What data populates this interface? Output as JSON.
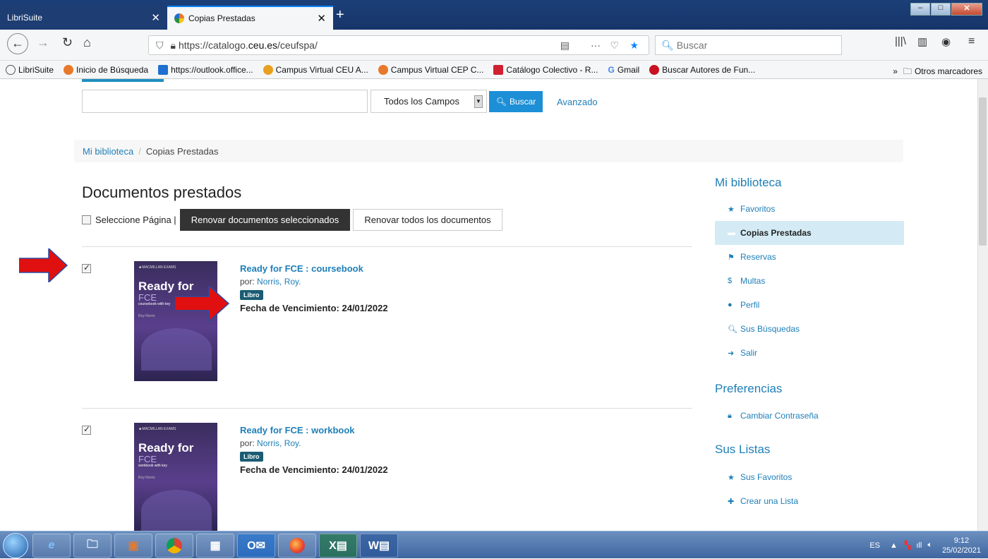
{
  "browser": {
    "tabs": [
      {
        "label": "LibriSuite",
        "active": false
      },
      {
        "label": "Copias Prestadas",
        "active": true
      }
    ],
    "new_tab": "+",
    "url_prefix": "https://catalogo.",
    "url_domain": "ceu.es",
    "url_suffix": "/ceufspa/",
    "search_placeholder": "Buscar",
    "bookmarks": [
      {
        "label": "LibriSuite",
        "color": "#555555"
      },
      {
        "label": "Inicio de Búsqueda",
        "color": "#e8792a"
      },
      {
        "label": "https://outlook.office...",
        "color": "#1e6fd0"
      },
      {
        "label": "Campus Virtual CEU A...",
        "color": "#e8a020"
      },
      {
        "label": "Campus Virtual CEP C...",
        "color": "#e8792a"
      },
      {
        "label": "Catálogo Colectivo - R...",
        "color": "#d02030"
      },
      {
        "label": "Gmail",
        "color": "#4285f4"
      },
      {
        "label": "Buscar Autores de Fun...",
        "color": "#c81020"
      }
    ],
    "other_bookmarks": "Otros marcadores"
  },
  "search": {
    "field_select": "Todos los Campos",
    "button": "Buscar",
    "advanced": "Avanzado"
  },
  "breadcrumb": {
    "home": "Mi biblioteca",
    "separator": "/",
    "current": "Copias Prestadas"
  },
  "main": {
    "heading": "Documentos prestados",
    "select_page": "Seleccione Página |",
    "renew_selected": "Renovar documentos seleccionados",
    "renew_all": "Renovar todos los documentos",
    "items": [
      {
        "title": "Ready for FCE : coursebook",
        "by_label": "por:",
        "author": "Norris, Roy.",
        "type": "Libro",
        "due": "Fecha de Vencimiento: 24/01/2022",
        "checked": true
      },
      {
        "title": "Ready for FCE : workbook",
        "by_label": "por:",
        "author": "Norris, Roy.",
        "type": "Libro",
        "due": "Fecha de Vencimiento: 24/01/2022",
        "checked": true
      }
    ]
  },
  "sidebar": {
    "section1": "Mi biblioteca",
    "items1": [
      "Favoritos",
      "Copias Prestadas",
      "Reservas",
      "Multas",
      "Perfil",
      "Sus Búsquedas",
      "Salir"
    ],
    "section2": "Preferencias",
    "items2": [
      "Cambiar Contraseña"
    ],
    "section3": "Sus Listas",
    "items3": [
      "Sus Favoritos",
      "Crear una Lista"
    ]
  },
  "taskbar": {
    "language": "ES",
    "time": "9:12",
    "date": "25/02/2021"
  },
  "colors": {
    "accent": "#1e7fb8",
    "arrow": "#e01010",
    "badge": "#1a5c73"
  }
}
